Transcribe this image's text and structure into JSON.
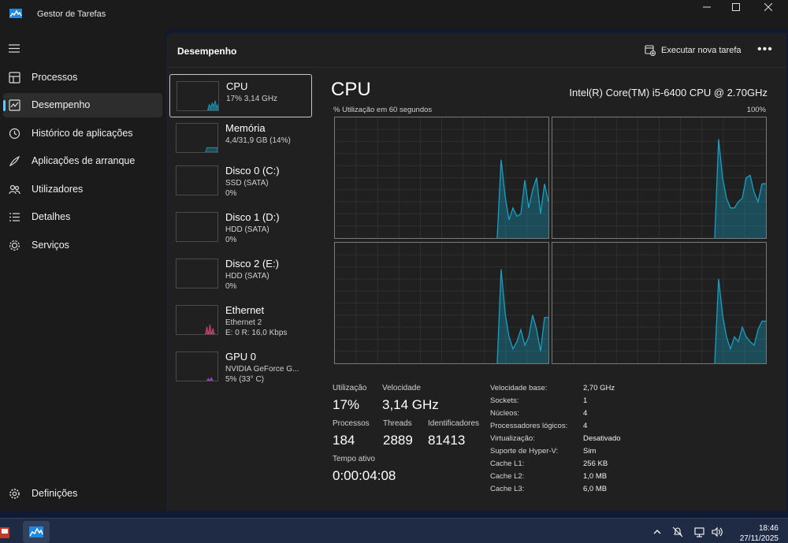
{
  "window": {
    "title": "Gestor de Tarefas"
  },
  "sidebar": {
    "items": [
      {
        "label": "Processos",
        "icon": "processes-icon"
      },
      {
        "label": "Desempenho",
        "icon": "performance-icon"
      },
      {
        "label": "Histórico de aplicações",
        "icon": "history-icon"
      },
      {
        "label": "Aplicações de arranque",
        "icon": "startup-icon"
      },
      {
        "label": "Utilizadores",
        "icon": "users-icon"
      },
      {
        "label": "Detalhes",
        "icon": "details-icon"
      },
      {
        "label": "Serviços",
        "icon": "services-icon"
      }
    ],
    "settings_label": "Definições",
    "active": "Desempenho"
  },
  "header": {
    "title": "Desempenho",
    "run_task_label": "Executar nova tarefa",
    "more_label": "•••"
  },
  "devices": [
    {
      "name": "CPU",
      "line1": "17% 3,14 GHz",
      "line2": ""
    },
    {
      "name": "Memória",
      "line1": "4,4/31,9 GB (14%)",
      "line2": ""
    },
    {
      "name": "Disco 0 (C:)",
      "line1": "SSD (SATA)",
      "line2": "0%"
    },
    {
      "name": "Disco 1 (D:)",
      "line1": "HDD (SATA)",
      "line2": "0%"
    },
    {
      "name": "Disco 2 (E:)",
      "line1": "HDD (SATA)",
      "line2": "0%"
    },
    {
      "name": "Ethernet",
      "line1": "Ethernet 2",
      "line2": "E: 0 R: 16,0 Kbps"
    },
    {
      "name": "GPU 0",
      "line1": "NVIDIA GeForce G...",
      "line2": "5% (33° C)"
    }
  ],
  "cpu": {
    "title": "CPU",
    "model": "Intel(R) Core(TM) i5-6400 CPU @ 2.70GHz",
    "graph_label": "% Utilização em 60 segundos",
    "graph_max": "100%",
    "stats": {
      "util_label": "Utilização",
      "util_value": "17%",
      "speed_label": "Velocidade",
      "speed_value": "3,14 GHz",
      "proc_label": "Processos",
      "proc_value": "184",
      "threads_label": "Threads",
      "threads_value": "2889",
      "handles_label": "Identificadores",
      "handles_value": "81413",
      "uptime_label": "Tempo ativo",
      "uptime_value": "0:00:04:08"
    },
    "specs": [
      {
        "label": "Velocidade base:",
        "value": "2,70 GHz"
      },
      {
        "label": "Sockets:",
        "value": "1"
      },
      {
        "label": "Núcleos:",
        "value": "4"
      },
      {
        "label": "Processadores lógicos:",
        "value": "4"
      },
      {
        "label": "Virtualização:",
        "value": "Desativado"
      },
      {
        "label": "Suporte de Hyper-V:",
        "value": "Sim"
      },
      {
        "label": "Cache L1:",
        "value": "256 KB"
      },
      {
        "label": "Cache L2:",
        "value": "1,0 MB"
      },
      {
        "label": "Cache L3:",
        "value": "6,0 MB"
      }
    ],
    "core_graphs": [
      [
        0,
        0,
        0,
        0,
        0,
        0,
        0,
        0,
        0,
        0,
        0,
        0,
        0,
        0,
        0,
        0,
        0,
        0,
        0,
        0,
        0,
        0,
        0,
        0,
        0,
        0,
        0,
        0,
        0,
        0,
        0,
        0,
        0,
        0,
        0,
        0,
        0,
        0,
        0,
        0,
        0,
        0,
        0,
        0,
        0,
        0,
        0,
        0,
        0,
        0,
        0,
        0,
        0,
        0,
        0,
        0,
        0,
        0,
        0,
        0,
        0,
        0,
        0,
        0,
        0,
        0,
        0,
        0,
        0,
        0,
        0,
        0,
        0,
        0,
        0,
        0,
        0,
        0,
        0,
        0,
        0,
        0,
        0,
        0,
        0,
        0,
        0,
        0,
        0,
        0,
        0,
        0,
        0,
        0,
        0,
        0,
        0,
        0,
        0,
        0,
        0,
        0,
        0,
        0,
        0,
        0,
        0,
        0,
        0,
        0,
        0,
        0,
        0,
        0,
        0,
        0,
        0,
        0,
        0,
        0,
        0,
        0,
        0,
        0,
        0,
        0,
        0,
        0,
        0,
        0,
        0,
        0,
        0,
        0,
        0,
        0,
        0,
        0,
        0,
        0,
        0,
        0,
        0,
        0,
        0,
        0,
        0,
        0,
        0,
        0,
        0,
        0,
        0,
        0,
        0,
        0,
        0,
        0,
        0,
        0,
        0,
        0,
        0,
        0,
        0,
        0,
        0,
        0,
        0,
        0,
        0,
        0,
        0,
        0,
        0,
        0,
        0,
        0,
        0,
        0,
        0,
        0,
        0,
        0,
        0,
        0,
        0,
        0,
        0,
        0,
        0,
        0,
        0,
        0,
        0,
        0,
        0,
        0,
        0,
        0,
        0,
        0,
        0,
        0,
        0,
        0,
        0,
        0,
        0,
        0,
        0,
        0,
        0,
        0,
        0,
        0,
        0,
        0,
        0,
        0,
        0,
        0,
        0,
        0,
        0,
        0,
        0,
        0,
        0,
        0,
        0,
        0,
        0,
        0,
        0,
        0,
        0,
        0,
        0,
        0,
        0,
        0,
        0,
        0,
        0,
        0,
        0,
        0,
        0,
        0,
        0,
        0,
        0,
        0,
        0,
        0,
        0,
        0,
        0,
        0,
        0,
        0
      ],
      [],
      [],
      []
    ],
    "core_series": [
      [
        0,
        65,
        35,
        15,
        25,
        18,
        20,
        48,
        25,
        40,
        50,
        20,
        45,
        30
      ],
      [
        0,
        82,
        50,
        33,
        25,
        25,
        30,
        33,
        50,
        52,
        38,
        30,
        45,
        45
      ],
      [
        0,
        78,
        42,
        22,
        12,
        18,
        28,
        15,
        22,
        40,
        28,
        10,
        38,
        38
      ],
      [
        0,
        70,
        40,
        22,
        12,
        22,
        18,
        30,
        22,
        18,
        15,
        28,
        35,
        35
      ]
    ],
    "color": "#17a0c4"
  },
  "taskbar": {
    "time": "18:46",
    "date": "27/11/2025"
  }
}
